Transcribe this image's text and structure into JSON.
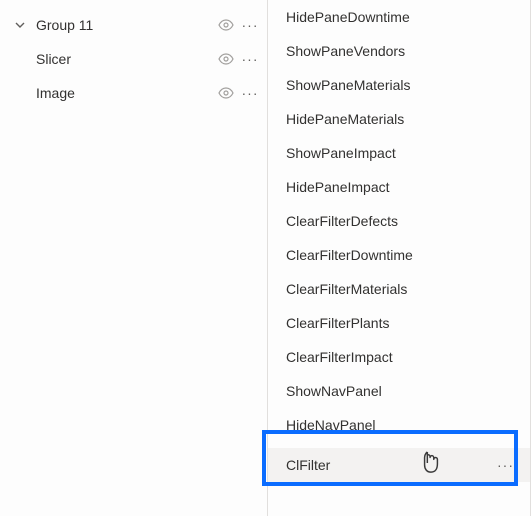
{
  "leftPane": {
    "group": {
      "label": "Group 11"
    },
    "items": [
      {
        "label": "Slicer"
      },
      {
        "label": "Image"
      }
    ]
  },
  "rightPane": {
    "items": [
      {
        "label": "HidePaneDowntime"
      },
      {
        "label": "ShowPaneVendors"
      },
      {
        "label": "ShowPaneMaterials"
      },
      {
        "label": "HidePaneMaterials"
      },
      {
        "label": "ShowPaneImpact"
      },
      {
        "label": "HidePaneImpact"
      },
      {
        "label": "ClearFilterDefects"
      },
      {
        "label": "ClearFilterDowntime"
      },
      {
        "label": "ClearFilterMaterials"
      },
      {
        "label": "ClearFilterPlants"
      },
      {
        "label": "ClearFilterImpact"
      },
      {
        "label": "ShowNavPanel"
      },
      {
        "label": "HideNavPanel"
      },
      {
        "label": "ClFilter",
        "selected": true
      }
    ]
  },
  "moreGlyph": "···"
}
